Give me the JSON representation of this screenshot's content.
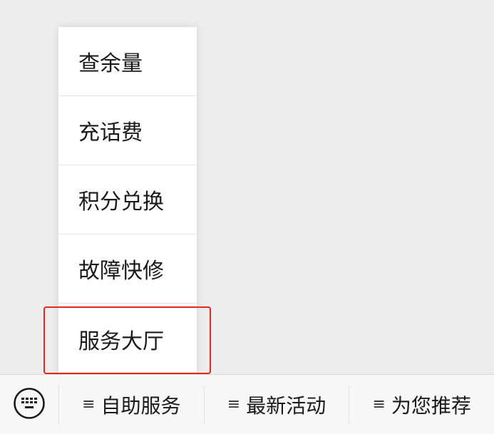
{
  "popup_menu": {
    "items": [
      {
        "label": "查余量"
      },
      {
        "label": "充话费"
      },
      {
        "label": "积分兑换"
      },
      {
        "label": "故障快修"
      },
      {
        "label": "服务大厅"
      }
    ],
    "highlighted_item": "服务大厅",
    "highlight_color": "#e8241c"
  },
  "bottom_bar": {
    "keyboard_icon": "keyboard-icon",
    "tabs": [
      {
        "glyph": "≡",
        "label": "自助服务"
      },
      {
        "glyph": "≡",
        "label": "最新活动"
      },
      {
        "glyph": "≡",
        "label": "为您推荐"
      }
    ]
  }
}
